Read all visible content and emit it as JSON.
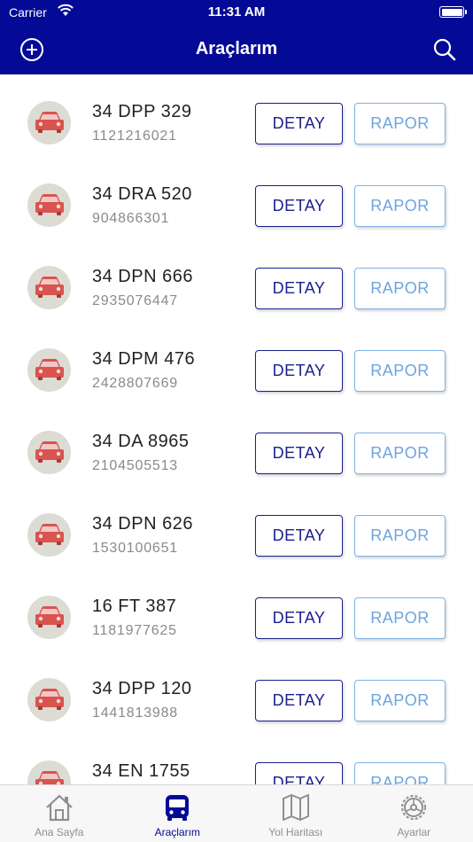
{
  "status_bar": {
    "carrier": "Carrier",
    "time": "11:31 AM"
  },
  "nav": {
    "title": "Araçlarım",
    "left_icon": "add-circle-icon",
    "right_icon": "search-icon"
  },
  "colors": {
    "nav_bg": "#050a96",
    "detay": "#1a1f8a",
    "rapor": "#6da4e0",
    "car": "#d9534f"
  },
  "vehicles": [
    {
      "plate": "34 DPP 329",
      "id": "1121216021",
      "detail_label": "DETAY",
      "report_label": "RAPOR"
    },
    {
      "plate": "34 DRA 520",
      "id": "904866301",
      "detail_label": "DETAY",
      "report_label": "RAPOR"
    },
    {
      "plate": "34 DPN 666",
      "id": "2935076447",
      "detail_label": "DETAY",
      "report_label": "RAPOR"
    },
    {
      "plate": "34 DPM 476",
      "id": "2428807669",
      "detail_label": "DETAY",
      "report_label": "RAPOR"
    },
    {
      "plate": "34 DA 8965",
      "id": "2104505513",
      "detail_label": "DETAY",
      "report_label": "RAPOR"
    },
    {
      "plate": "34 DPN 626",
      "id": "1530100651",
      "detail_label": "DETAY",
      "report_label": "RAPOR"
    },
    {
      "plate": "16 FT 387",
      "id": "1181977625",
      "detail_label": "DETAY",
      "report_label": "RAPOR"
    },
    {
      "plate": "34 DPP 120",
      "id": "1441813988",
      "detail_label": "DETAY",
      "report_label": "RAPOR"
    },
    {
      "plate": "34 EN 1755",
      "id": "",
      "detail_label": "DETAY",
      "report_label": "RAPOR"
    }
  ],
  "tabs": [
    {
      "label": "Ana Sayfa",
      "icon": "home-icon",
      "active": false
    },
    {
      "label": "Araçlarım",
      "icon": "bus-icon",
      "active": true
    },
    {
      "label": "Yol Haritası",
      "icon": "map-icon",
      "active": false
    },
    {
      "label": "Ayarlar",
      "icon": "gear-icon",
      "active": false
    }
  ]
}
